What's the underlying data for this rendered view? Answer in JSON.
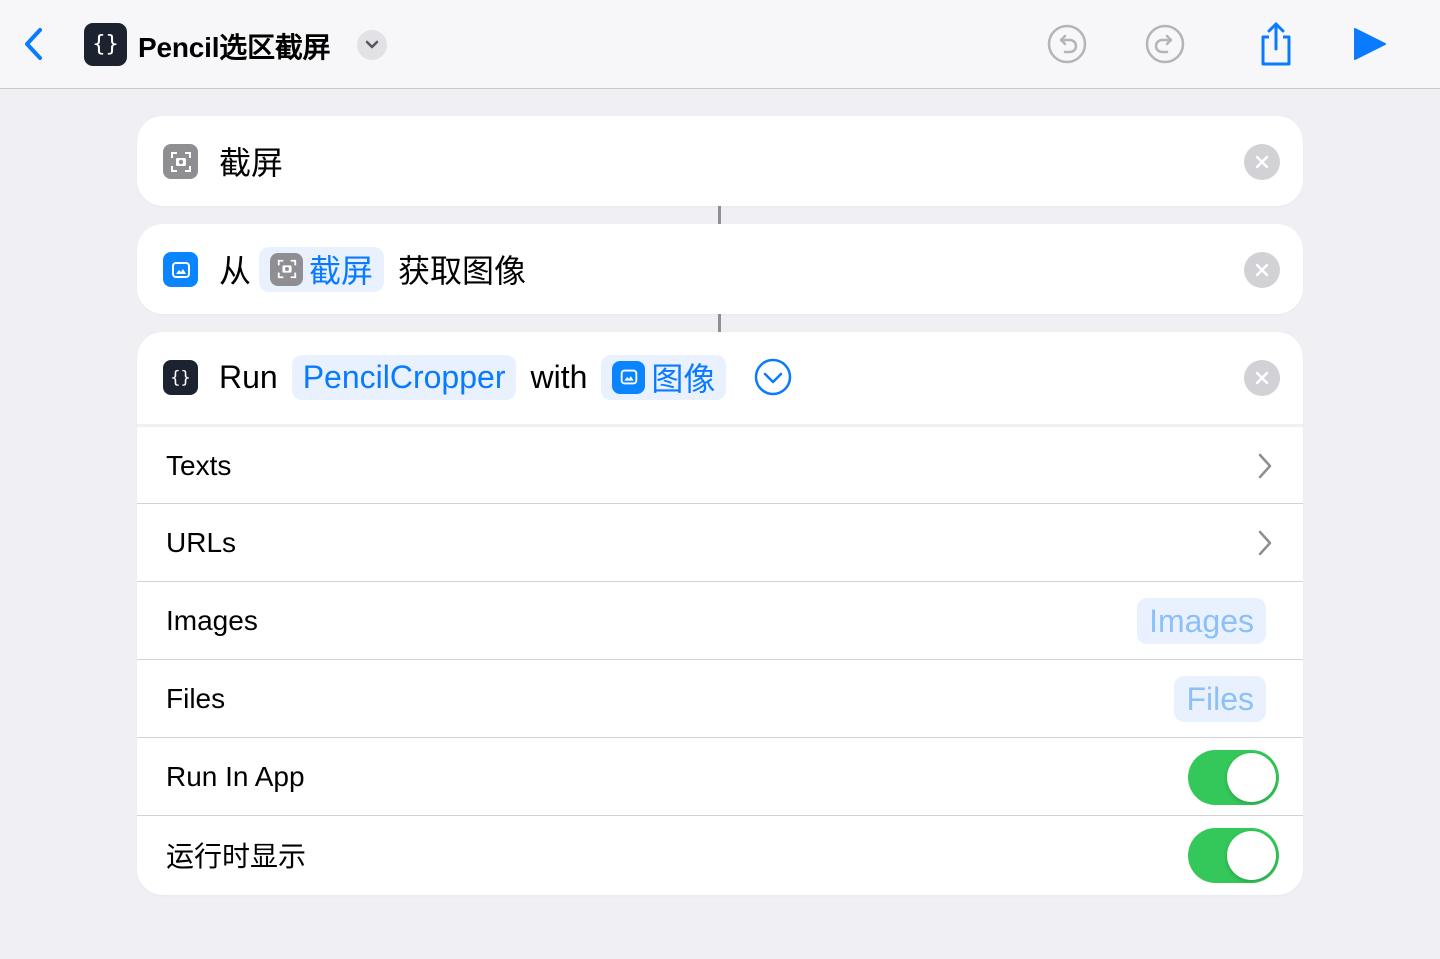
{
  "header": {
    "title": "Pencil选区截屏",
    "app_icon_glyph": "{}",
    "icons": [
      "back-chevron-icon",
      "undo-icon",
      "redo-icon",
      "share-icon",
      "play-icon"
    ]
  },
  "actions": [
    {
      "id": "screenshot",
      "icon": "screenshot-icon",
      "label": "截屏"
    },
    {
      "id": "get-images",
      "icon": "photo-icon",
      "prefix": "从",
      "token_label": "截屏",
      "suffix": "获取图像"
    },
    {
      "id": "run-script",
      "icon": "script-icon",
      "run_label": "Run",
      "script_token": "PencilCropper",
      "with_label": "with",
      "input_token": "图像"
    }
  ],
  "params": {
    "texts": {
      "label": "Texts"
    },
    "urls": {
      "label": "URLs"
    },
    "images": {
      "label": "Images",
      "placeholder": "Images"
    },
    "files": {
      "label": "Files",
      "placeholder": "Files"
    },
    "run_in_app": {
      "label": "Run In App",
      "value": true
    },
    "show_when_run": {
      "label": "运行时显示",
      "value": true
    }
  },
  "colors": {
    "accent": "#0A84FF",
    "toggle_on": "#34C759",
    "background": "#EFEFF4"
  }
}
